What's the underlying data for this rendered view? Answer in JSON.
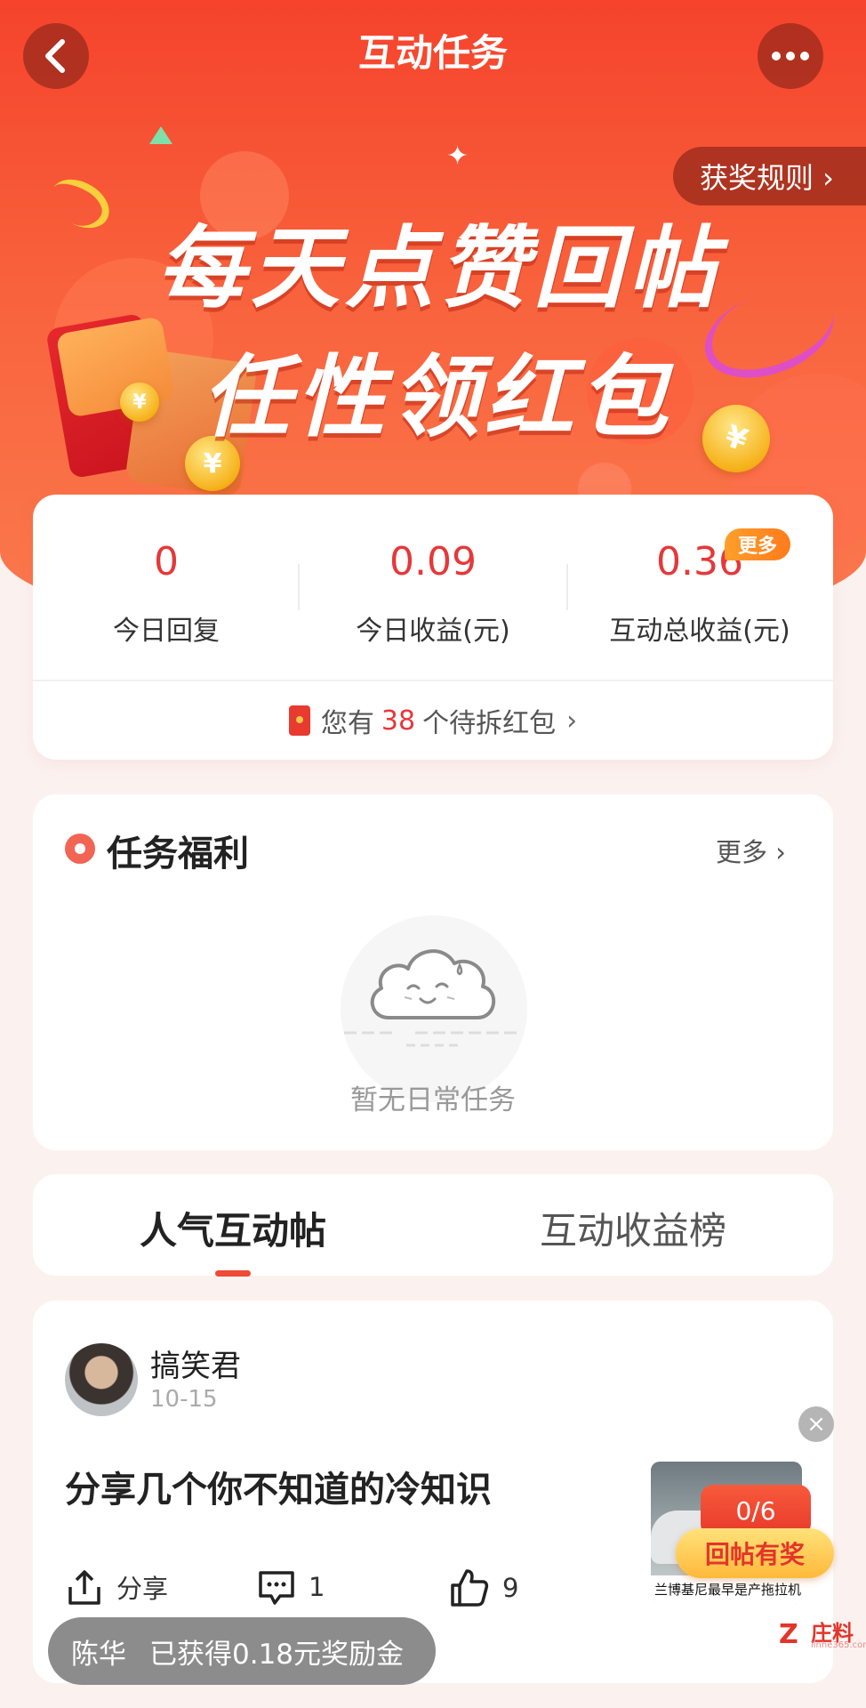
{
  "nav": {
    "title": "互动任务",
    "back_glyph": "‹",
    "more_glyph": "•••"
  },
  "banner": {
    "rules_label": "获奖规则 ›",
    "headline_line1": "每天点赞回帖",
    "headline_line2": "任性领红包",
    "coin_glyph": "¥"
  },
  "stats": [
    {
      "value": "0",
      "label": "今日回复"
    },
    {
      "value": "0.09",
      "label": "今日收益(元)"
    },
    {
      "value": "0.36",
      "label": "互动总收益(元)"
    }
  ],
  "stats_more_badge": "更多",
  "redpack": {
    "prefix": "您有",
    "count": "38",
    "suffix": "个待拆红包",
    "chevron": "›"
  },
  "task": {
    "title": "任务福利",
    "more_label": "更多 ›",
    "empty_text": "暂无日常任务"
  },
  "tabs": [
    {
      "label": "人气互动帖",
      "active": true
    },
    {
      "label": "互动收益榜",
      "active": false
    }
  ],
  "post": {
    "author": "搞笑君",
    "date": "10-15",
    "title": "分享几个你不知道的冷知识",
    "share_label": "分享",
    "comment_count": "1",
    "like_count": "9"
  },
  "float_widget": {
    "close_glyph": "×",
    "caption": "兰博基尼最早是产拖拉机的",
    "progress": "0/6",
    "button_label": "回帖有奖"
  },
  "toast": {
    "name": "陈华",
    "message": "已获得0.18元奖励金"
  },
  "watermark": {
    "logo_glyph": "Z",
    "text": "庄料",
    "sub": "linhe365.com"
  },
  "colors": {
    "accent": "#e5383a",
    "banner_top": "#f5432c",
    "page_bg": "#fbf2f0"
  }
}
